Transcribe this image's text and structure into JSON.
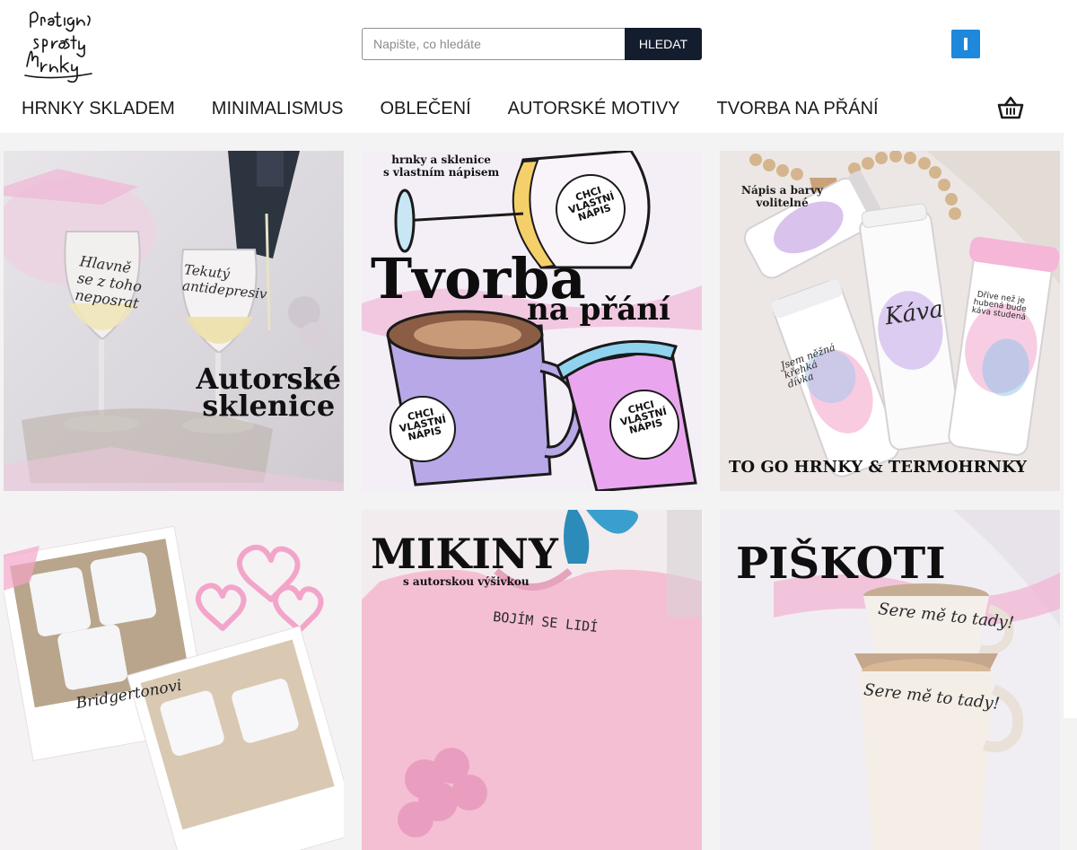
{
  "search": {
    "placeholder": "Napište, co hledáte",
    "button_label": "HLEDAT"
  },
  "nav": {
    "items": [
      {
        "label": "HRNKY SKLADEM"
      },
      {
        "label": "MINIMALISMUS"
      },
      {
        "label": "OBLEČENÍ"
      },
      {
        "label": "AUTORSKÉ MOTIVY"
      },
      {
        "label": "TVORBA NA PŘÁNÍ"
      }
    ]
  },
  "header": {
    "account_icon": "user-icon",
    "cart_icon": "basket-icon",
    "account_color": "#1e88dc",
    "button_color": "#141d2e"
  },
  "tiles": [
    {
      "title_line1": "Autorské",
      "title_line2": "sklenice",
      "glass_text1": "Hlavně",
      "glass_text2": "se z toho",
      "glass_text3": "neposrat",
      "glass_text4": "Tekutý",
      "glass_text5": "antidepresiv"
    },
    {
      "subtitle_line1": "hrnky a sklenice",
      "subtitle_line2": "s vlastním nápisem",
      "title_line1": "Tvorba",
      "title_line2": "na přání",
      "badge": "CHCI VLASTNÍ NÁPIS"
    },
    {
      "subtitle_line1": "Nápis a barvy",
      "subtitle_line2": "volitelné",
      "title": "TO GO HRNKY & TERMOHRNKY",
      "cup_text1": "Káva",
      "cup_text2": "Jsem něžná křehká dívka",
      "cup_text3": "Dříve než je hubená bude káva studená"
    },
    {
      "label": "Bridgertonovi"
    },
    {
      "title": "MIKINY",
      "subtitle": "s autorskou výšivkou",
      "shirt_text": "BOJÍM SE LIDÍ"
    },
    {
      "title": "PIŠKOTI",
      "cup_text": "Sere mě to tady!"
    }
  ]
}
